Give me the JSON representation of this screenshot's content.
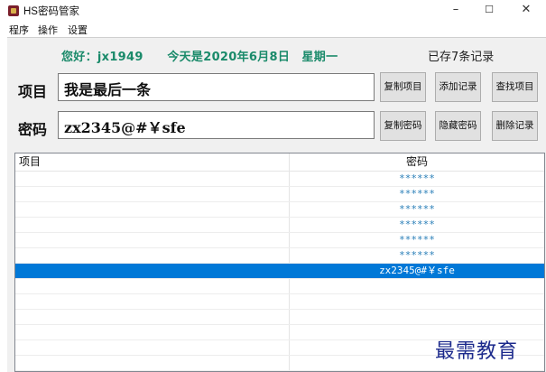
{
  "window": {
    "title": "HS密码管家",
    "minimize": "–",
    "maximize": "☐",
    "close": "✕"
  },
  "menu": [
    "程序",
    "操作",
    "设置"
  ],
  "header": {
    "greeting": "您好：jx1949　　今天是2020年6月8日　星期一",
    "record_count": "已存7条记录"
  },
  "form": {
    "item_label": "项目",
    "item_value": "我是最后一条",
    "password_label": "密码",
    "password_value": "zx2345@#￥sfe"
  },
  "buttons": {
    "copy_item": "复制项目",
    "add_record": "添加记录",
    "find_item": "查找项目",
    "copy_password": "复制密码",
    "hide_password": "隐藏密码",
    "delete_record": "删除记录"
  },
  "list": {
    "columns": [
      "项目",
      "密码"
    ],
    "rows": [
      {
        "item": "",
        "password": "******"
      },
      {
        "item": "",
        "password": "******"
      },
      {
        "item": "",
        "password": "******"
      },
      {
        "item": "",
        "password": "******"
      },
      {
        "item": "",
        "password": "******"
      },
      {
        "item": "",
        "password": "******"
      },
      {
        "item": "",
        "password": "zx2345@#￥sfe",
        "selected": true
      }
    ],
    "empty_rows": 6
  },
  "watermark": "最需教育",
  "colors": {
    "selection": "#0078d7",
    "greeting": "#1a8a6a",
    "masked": "#2a7fb8"
  }
}
